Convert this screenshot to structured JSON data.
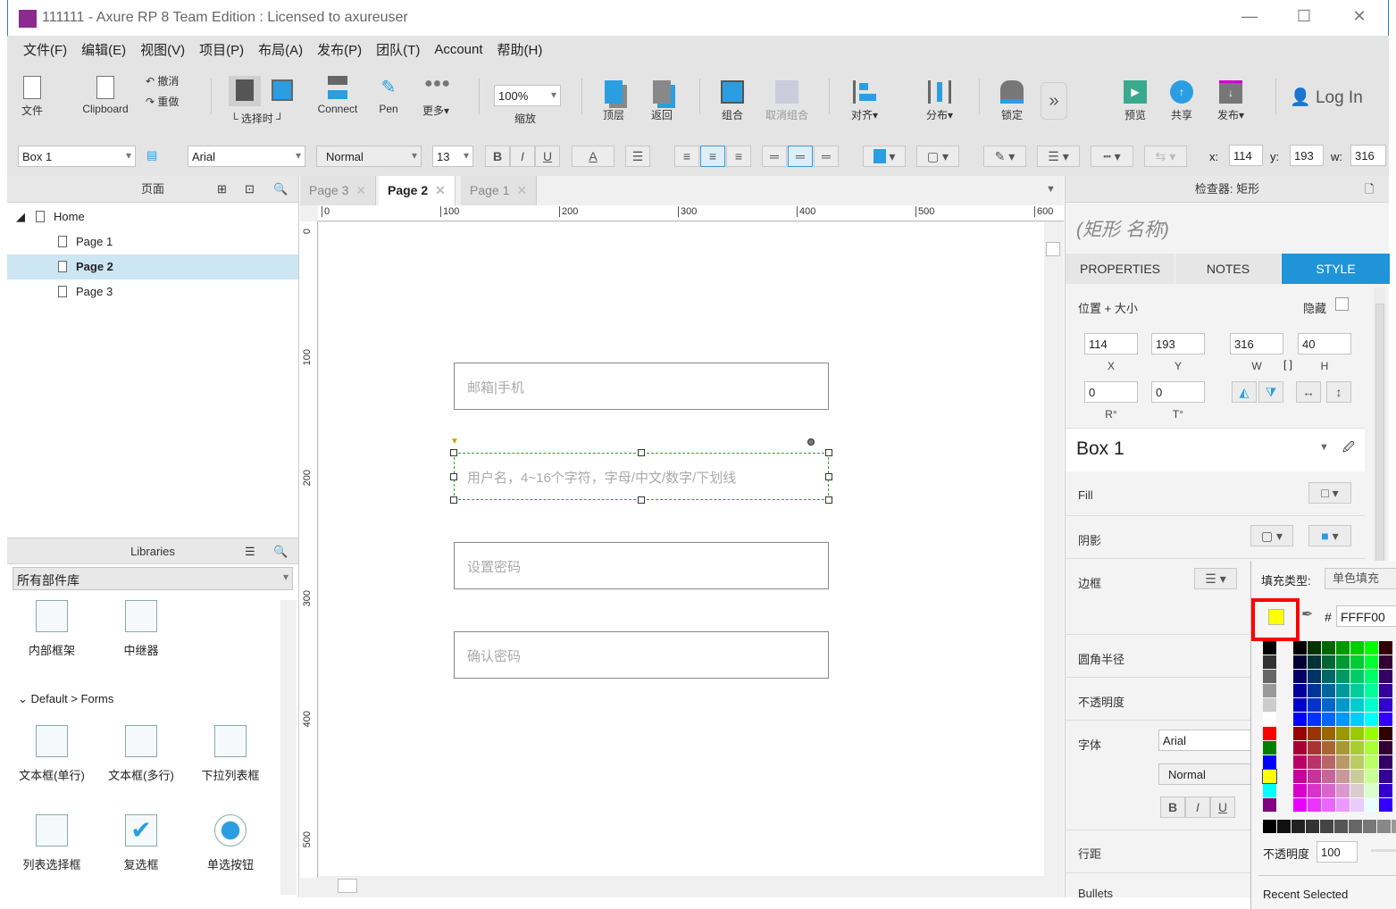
{
  "window": {
    "title": "111111 - Axure RP 8 Team Edition : Licensed to axureuser",
    "minimize": "—",
    "maximize": "☐",
    "close": "✕"
  },
  "menu": [
    "文件(F)",
    "编辑(E)",
    "视图(V)",
    "项目(P)",
    "布局(A)",
    "发布(P)",
    "团队(T)",
    "Account",
    "帮助(H)"
  ],
  "toolbar": {
    "file": "文件",
    "clipboard": "Clipboard",
    "undo": "撤消",
    "redo": "重做",
    "select_mode": "└ 选择时 ┘",
    "connect": "Connect",
    "pen": "Pen",
    "more": "更多▾",
    "zoom_value": "100%",
    "zoom": "缩放",
    "front": "顶层",
    "back": "返回",
    "group": "组合",
    "ungroup": "取消组合",
    "align": "对齐▾",
    "distribute": "分布▾",
    "lock": "锁定",
    "overflow": "»",
    "preview": "预览",
    "share": "共享",
    "publish": "发布▾",
    "login": "Log In"
  },
  "format": {
    "widget_name": "Box 1",
    "font": "Arial",
    "style": "Normal",
    "size": "13",
    "bold": "B",
    "italic": "I",
    "underline": "U",
    "text_color": "A",
    "x_label": "x:",
    "x": "114",
    "y_label": "y:",
    "y": "193",
    "w_label": "w:",
    "w": "316"
  },
  "pages": {
    "title": "页面",
    "items": [
      {
        "label": "Home"
      },
      {
        "label": "Page 1"
      },
      {
        "label": "Page 2",
        "selected": true
      },
      {
        "label": "Page 3"
      }
    ]
  },
  "libraries": {
    "title": "Libraries",
    "selected": "所有部件库",
    "top_widgets": [
      "内部框架",
      "中继器"
    ],
    "section": "Default > Forms",
    "widgets": [
      "文本框(单行)",
      "文本框(多行)",
      "下拉列表框",
      "列表选择框",
      "复选框",
      "单选按钮"
    ]
  },
  "tabs": [
    {
      "label": "Page 3"
    },
    {
      "label": "Page 2",
      "active": true
    },
    {
      "label": "Page 1"
    }
  ],
  "ruler": {
    "h": [
      "0",
      "100",
      "200",
      "300",
      "400",
      "500",
      "600"
    ],
    "v": [
      "0",
      "100",
      "200",
      "300",
      "400",
      "500"
    ]
  },
  "canvas": {
    "boxes": [
      "邮箱|手机",
      "用户名，4~16个字符，字母/中文/数字/下划线",
      "设置密码",
      "确认密码"
    ]
  },
  "inspector": {
    "title": "检查器: 矩形",
    "name_placeholder": "(矩形 名称)",
    "tabs": [
      "PROPERTIES",
      "NOTES",
      "STYLE"
    ],
    "active_tab": "STYLE",
    "pos_size": "位置 + 大小",
    "hidden": "隐藏",
    "x": "114",
    "y": "193",
    "w": "316",
    "h": "40",
    "x_l": "X",
    "y_l": "Y",
    "w_l": "W",
    "h_l": "H",
    "r": "0",
    "t": "0",
    "r_l": "R°",
    "t_l": "T°",
    "style_name": "Box 1",
    "fill": "Fill",
    "shadow": "阴影",
    "border": "边框",
    "radius": "圆角半径",
    "opacity": "不透明度",
    "font": "字体",
    "font_value": "Arial",
    "font_style": "Normal",
    "line_spacing": "行距",
    "bullets": "Bullets"
  },
  "picker": {
    "fill_type_label": "填充类型:",
    "fill_type": "单色填充",
    "hash": "#",
    "hex": "FFFF00",
    "selected_color": "#FFFF00",
    "opacity_label": "不透明度",
    "opacity": "100",
    "recent": "Recent Selected",
    "left_swatches": [
      "#000000",
      "#333333",
      "#666666",
      "#999999",
      "#cccccc",
      "#ffffff",
      "#ff0000",
      "#008000",
      "#0000ff",
      "#ffff00",
      "#00ffff",
      "#800080"
    ]
  },
  "colors": {
    "accent": "#2094d8",
    "selection": "#cde6f4",
    "highlight": "#ff0000"
  }
}
